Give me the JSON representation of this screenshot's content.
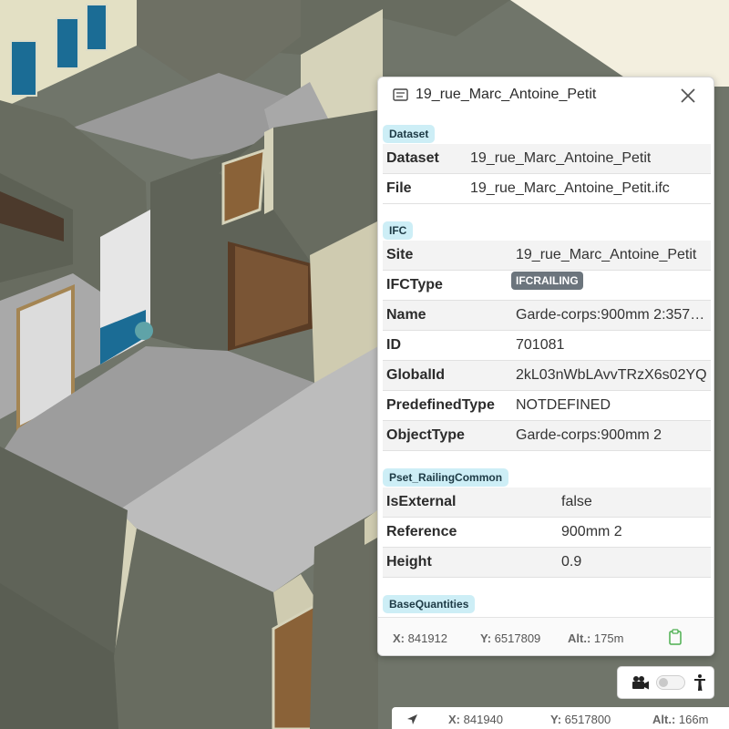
{
  "panel": {
    "title": "19_rue_Marc_Antoine_Petit",
    "sections": {
      "dataset": {
        "label": "Dataset",
        "rows": [
          {
            "key": "Dataset",
            "value": "19_rue_Marc_Antoine_Petit"
          },
          {
            "key": "File",
            "value": "19_rue_Marc_Antoine_Petit.ifc"
          }
        ]
      },
      "ifc": {
        "label": "IFC",
        "rows": [
          {
            "key": "Site",
            "value": "19_rue_Marc_Antoine_Petit"
          },
          {
            "key": "IFCType",
            "value": "IFCRAILING"
          },
          {
            "key": "Name",
            "value": "Garde-corps:900mm 2:357…"
          },
          {
            "key": "ID",
            "value": "701081"
          },
          {
            "key": "GlobalId",
            "value": "2kL03nWbLAvvTRzX6s02YQ"
          },
          {
            "key": "PredefinedType",
            "value": "NOTDEFINED"
          },
          {
            "key": "ObjectType",
            "value": "Garde-corps:900mm 2"
          }
        ]
      },
      "pset": {
        "label": "Pset_RailingCommon",
        "rows": [
          {
            "key": "IsExternal",
            "value": "false"
          },
          {
            "key": "Reference",
            "value": "900mm 2"
          },
          {
            "key": "Height",
            "value": "0.9"
          }
        ]
      },
      "base": {
        "label": "BaseQuantities"
      }
    },
    "footer": {
      "x_label": "X:",
      "x_value": "841912",
      "y_label": "Y:",
      "y_value": "6517809",
      "alt_label": "Alt.:",
      "alt_value": "175m"
    }
  },
  "camera_controls": {
    "camera_icon": "video-camera-icon",
    "walk_icon": "pedestrian-icon",
    "toggle_on": false
  },
  "statusbar": {
    "x_label": "X:",
    "x_value": "841940",
    "y_label": "Y:",
    "y_value": "6517800",
    "alt_label": "Alt.:",
    "alt_value": "166m"
  },
  "colors": {
    "tag_bg": "#cdeef6",
    "badge_bg": "#6c757d",
    "clipboard_icon": "#4caf50"
  }
}
